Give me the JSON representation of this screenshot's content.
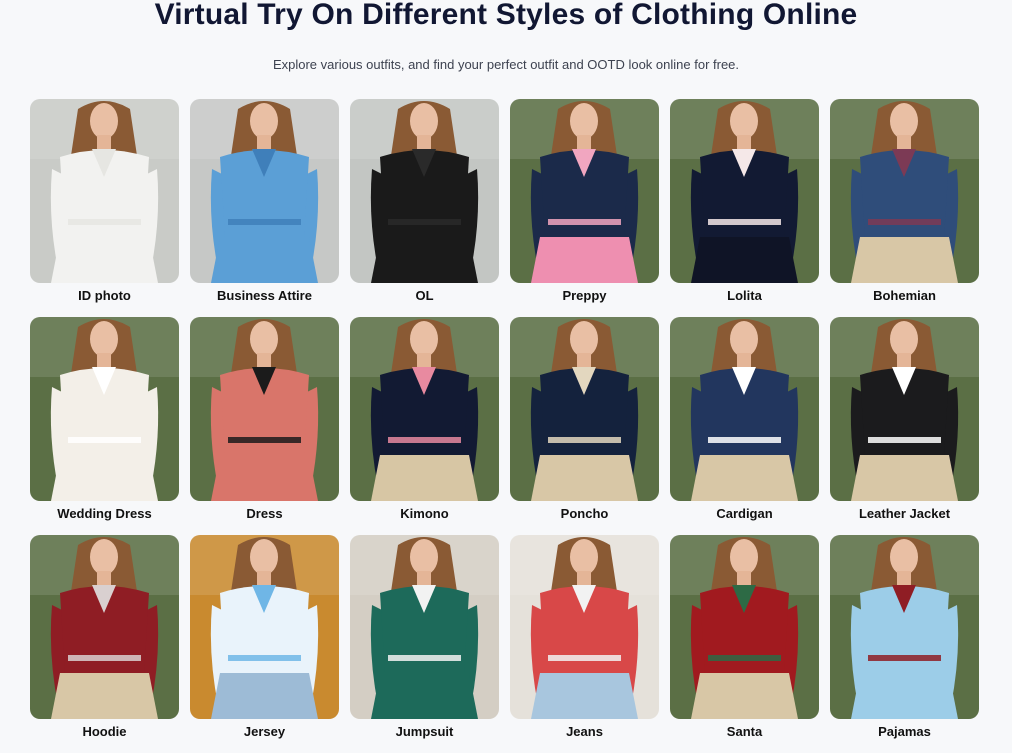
{
  "header": {
    "title": "Virtual Try On Different Styles of Clothing Online",
    "subtitle": "Explore various outfits, and find your perfect outfit and OOTD look online for free."
  },
  "styles": [
    {
      "label": "ID photo",
      "bg": "#c9cbc7",
      "garment": "#f2f2f0",
      "accent": "#e6e6e2",
      "lower": "#f2f2f0"
    },
    {
      "label": "Business Attire",
      "bg": "#c6c8c6",
      "garment": "#5b9fd6",
      "accent": "#3f7fba",
      "lower": "#5b9fd6"
    },
    {
      "label": "OL",
      "bg": "#c3c6c3",
      "garment": "#1a1a1a",
      "accent": "#2a2a2a",
      "lower": "#1a1a1a"
    },
    {
      "label": "Preppy",
      "bg": "#5b6f45",
      "garment": "#1b2a4a",
      "accent": "#f1a6c0",
      "lower": "#ee8fb0"
    },
    {
      "label": "Lolita",
      "bg": "#5b6f45",
      "garment": "#121a33",
      "accent": "#f5e8e8",
      "lower": "#0f1426"
    },
    {
      "label": "Bohemian",
      "bg": "#5b6f45",
      "garment": "#2f4d7a",
      "accent": "#7c3a55",
      "lower": "#d8c7a6"
    },
    {
      "label": "Wedding Dress",
      "bg": "#5b6f45",
      "garment": "#f3efe8",
      "accent": "#ffffff",
      "lower": "#f3efe8"
    },
    {
      "label": "Dress",
      "bg": "#5b6f45",
      "garment": "#d9756a",
      "accent": "#1b1b1b",
      "lower": "#d9756a"
    },
    {
      "label": "Kimono",
      "bg": "#5b6f45",
      "garment": "#121a33",
      "accent": "#e88aa0",
      "lower": "#d7c6a4"
    },
    {
      "label": "Poncho",
      "bg": "#5b6f45",
      "garment": "#14223d",
      "accent": "#e3d7bf",
      "lower": "#d8c7a6"
    },
    {
      "label": "Cardigan",
      "bg": "#5b6f45",
      "garment": "#22365e",
      "accent": "#ffffff",
      "lower": "#d8c7a6"
    },
    {
      "label": "Leather Jacket",
      "bg": "#5b6f45",
      "garment": "#1b1b1d",
      "accent": "#ffffff",
      "lower": "#d8c7a6"
    },
    {
      "label": "Hoodie",
      "bg": "#5b6f45",
      "garment": "#8f1d24",
      "accent": "#d9d0d0",
      "lower": "#d8c7a6"
    },
    {
      "label": "Jersey",
      "bg": "#c98a2f",
      "garment": "#e9f3fb",
      "accent": "#6fb6e6",
      "lower": "#9dbbd6"
    },
    {
      "label": "Jumpsuit",
      "bg": "#d4cec4",
      "garment": "#1d6a5a",
      "accent": "#f2f2f2",
      "lower": "#1d6a5a"
    },
    {
      "label": "Jeans",
      "bg": "#e5e1da",
      "garment": "#d84848",
      "accent": "#f2f2f2",
      "lower": "#a8c6de"
    },
    {
      "label": "Santa",
      "bg": "#5b6f45",
      "garment": "#a11a1f",
      "accent": "#2d6a45",
      "lower": "#d8c7a6"
    },
    {
      "label": "Pajamas",
      "bg": "#5b6f45",
      "garment": "#9ccde8",
      "accent": "#8f1d24",
      "lower": "#9ccde8"
    }
  ]
}
